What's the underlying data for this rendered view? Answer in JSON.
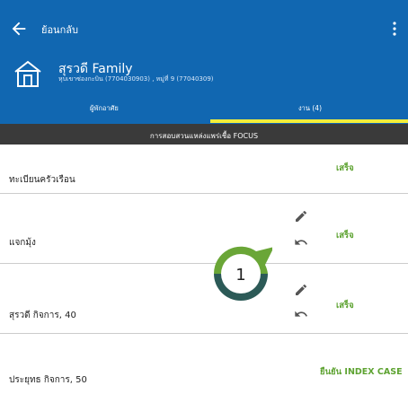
{
  "header": {
    "back_label": "ย้อนกลับ",
    "back_icon": "arrow-left-icon",
    "menu_icon": "more-vertical-icon"
  },
  "family": {
    "name": "สุรวดี Family",
    "subtitle": "หุบเขาซ่องกะบิน (7704030903)  ,  หมู่ที่ 9 (77040309)",
    "icon": "house-icon"
  },
  "tabs": [
    {
      "label": "ผู้พักอาศัย",
      "active": false
    },
    {
      "label": "งาน (4)",
      "active": true
    }
  ],
  "focus_banner": "การสอบสวนแหล่งแพร่เชื้อ FOCUS",
  "tasks": [
    {
      "label": "ทะเบียนครัวเรือน",
      "status": "เสร็จ",
      "has_actions": false
    },
    {
      "label": "แจกมุ้ง",
      "status": "เสร็จ",
      "has_actions": true
    },
    {
      "label": "สุรวดี  กิจการ, 40",
      "status": "เสร็จ",
      "has_actions": true
    },
    {
      "label": "ประยุทธ  กิจการ, 50",
      "status": "ยืนยัน INDEX CASE",
      "has_actions": false
    }
  ],
  "callout": {
    "number": "1"
  },
  "colors": {
    "header_bg": "#1167b1",
    "tab_indicator": "#f2ee3a",
    "banner_bg": "#3a3a3a",
    "status_green": "#5ea332",
    "badge_green": "#6aa637",
    "badge_dark": "#2c5a57"
  }
}
